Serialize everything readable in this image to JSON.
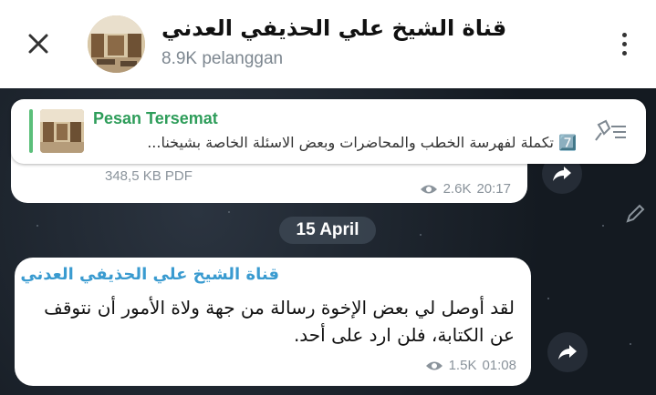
{
  "header": {
    "title": "قناة الشيخ علي الحذيفي العدني",
    "subtitle": "8.9K pelanggan",
    "close_icon": "close-icon",
    "menu_icon": "more-vertical-icon"
  },
  "pinned": {
    "title": "Pesan Tersemat",
    "text": "7️⃣ تكملة لفهرسة الخطب والمحاضرات وبعض الاسئلة  الخاصة بشيخنا...",
    "icon": "pin-list-icon"
  },
  "messages": [
    {
      "file_size": "348,5 KB PDF",
      "views": "2.6K",
      "time": "20:17"
    },
    {
      "sender": "قناة الشيخ علي الحذيفي العدني",
      "text": "لقد أوصل لي بعض الإخوة رسالة من جهة ولاة الأمور أن نتوقف عن الكتابة، فلن ارد على أحد.",
      "views": "1.5K",
      "time": "01:08"
    }
  ],
  "date_separator": "15 April",
  "colors": {
    "accent_green": "#2e9d5a",
    "sender_blue": "#3a9bd0",
    "chat_bg": "#17212b"
  }
}
